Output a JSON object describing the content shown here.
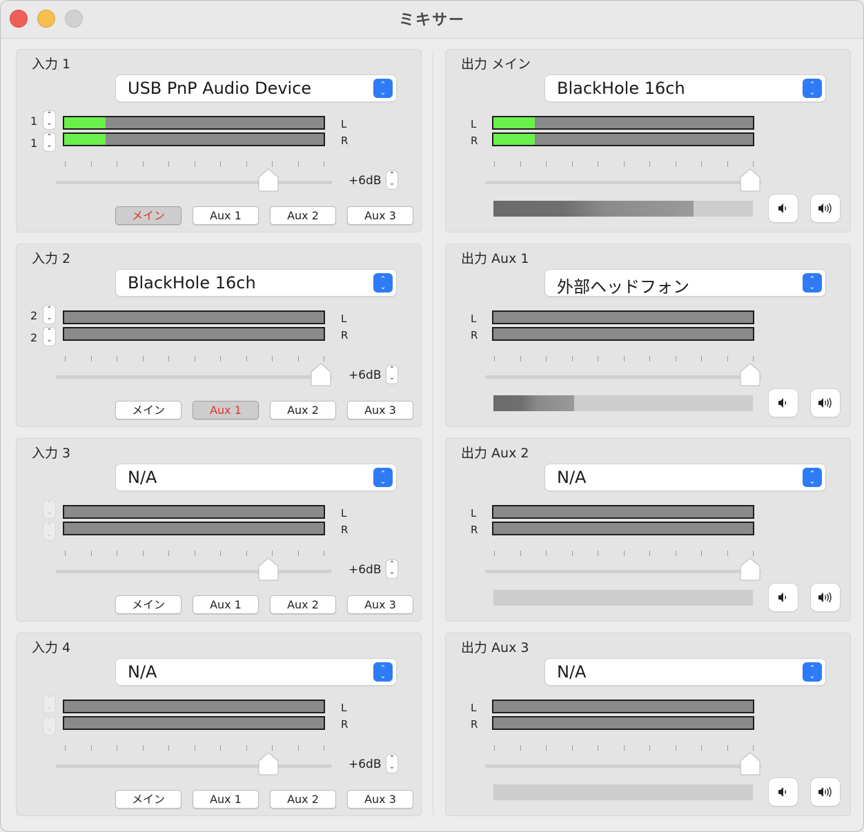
{
  "window": {
    "title": "ミキサー"
  },
  "inputs": [
    {
      "title": "入力 1",
      "device": "USB PnP Audio Device",
      "ch_l": "1",
      "ch_r": "1",
      "level_l": 0.16,
      "level_r": 0.16,
      "gain": "+6dB",
      "gain_fraction": 0.77,
      "stepper_enabled": true,
      "routes": [
        {
          "label": "メイン",
          "active": true
        },
        {
          "label": "Aux 1",
          "active": false
        },
        {
          "label": "Aux 2",
          "active": false
        },
        {
          "label": "Aux 3",
          "active": false
        }
      ]
    },
    {
      "title": "入力 2",
      "device": "BlackHole 16ch",
      "ch_l": "2",
      "ch_r": "2",
      "level_l": 0,
      "level_r": 0,
      "gain": "+6dB",
      "gain_fraction": 0.96,
      "stepper_enabled": true,
      "routes": [
        {
          "label": "メイン",
          "active": false
        },
        {
          "label": "Aux 1",
          "active": true
        },
        {
          "label": "Aux 2",
          "active": false
        },
        {
          "label": "Aux 3",
          "active": false
        }
      ]
    },
    {
      "title": "入力 3",
      "device": "N/A",
      "ch_l": "",
      "ch_r": "",
      "level_l": 0,
      "level_r": 0,
      "gain": "+6dB",
      "gain_fraction": 0.77,
      "stepper_enabled": false,
      "routes": [
        {
          "label": "メイン",
          "active": false
        },
        {
          "label": "Aux 1",
          "active": false
        },
        {
          "label": "Aux 2",
          "active": false
        },
        {
          "label": "Aux 3",
          "active": false
        }
      ]
    },
    {
      "title": "入力 4",
      "device": "N/A",
      "ch_l": "",
      "ch_r": "",
      "level_l": 0,
      "level_r": 0,
      "gain": "+6dB",
      "gain_fraction": 0.77,
      "stepper_enabled": false,
      "routes": [
        {
          "label": "メイン",
          "active": false
        },
        {
          "label": "Aux 1",
          "active": false
        },
        {
          "label": "Aux 2",
          "active": false
        },
        {
          "label": "Aux 3",
          "active": false
        }
      ]
    }
  ],
  "outputs": [
    {
      "title": "出力 メイン",
      "device": "BlackHole 16ch",
      "level_l": 0.16,
      "level_r": 0.16,
      "volume_fraction": 0.96,
      "output_level": 0.77
    },
    {
      "title": "出力 Aux 1",
      "device": "外部ヘッドフォン",
      "level_l": 0,
      "level_r": 0,
      "volume_fraction": 0.96,
      "output_level": 0.31
    },
    {
      "title": "出力 Aux 2",
      "device": "N/A",
      "level_l": 0,
      "level_r": 0,
      "volume_fraction": 0.96,
      "output_level": 0
    },
    {
      "title": "出力 Aux 3",
      "device": "N/A",
      "level_l": 0,
      "level_r": 0,
      "volume_fraction": 0.96,
      "output_level": 0
    }
  ],
  "labels": {
    "left": "L",
    "right": "R"
  },
  "icons": {
    "volume_down": "speaker-low-icon",
    "volume_up": "speaker-high-icon",
    "popup": "chevron-updown-icon"
  },
  "colors": {
    "meter_green": "#6af04a",
    "active_route_text": "#e0352a",
    "select_accent": "#2f7bf6"
  }
}
